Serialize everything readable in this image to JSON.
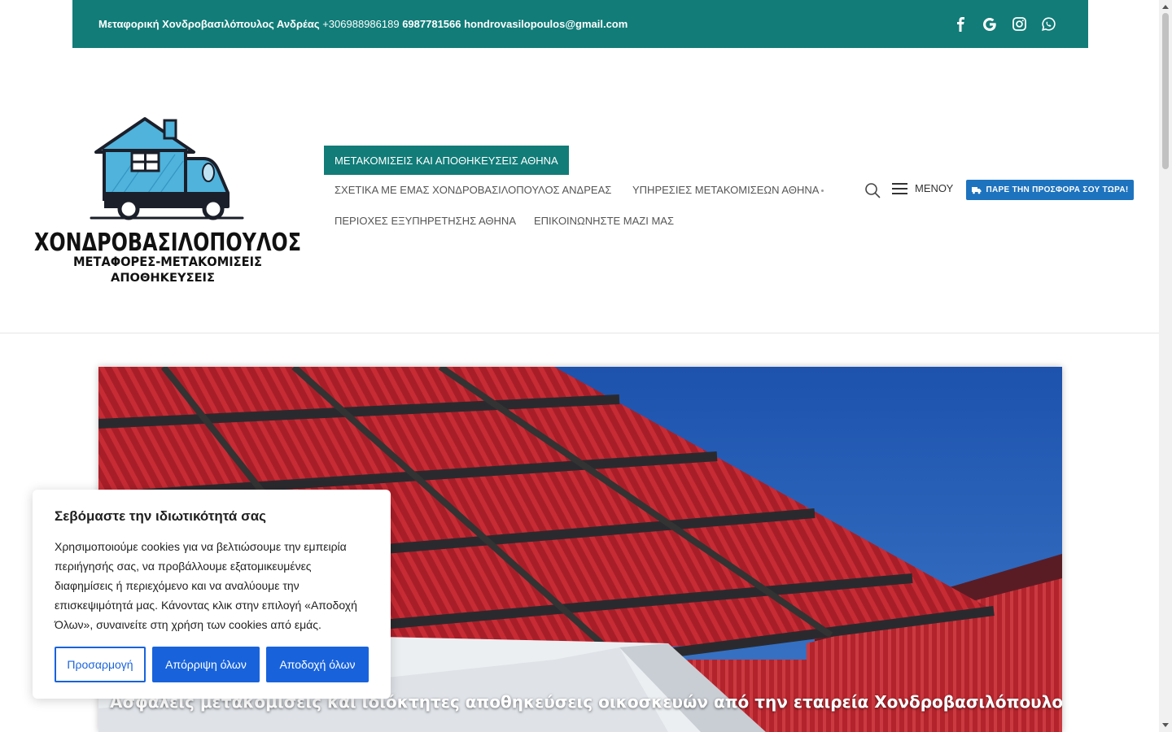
{
  "topbar": {
    "company": "Μεταφορική Χονδροβασιλόπουλος Ανδρέας ",
    "phone1": "+306988986189",
    "phone2": " 6987781566 ",
    "email": "hondrovasilopoulos@gmail.com",
    "social_icons": [
      "facebook-icon",
      "google-icon",
      "instagram-icon",
      "whatsapp-icon"
    ]
  },
  "logo": {
    "line1": "ΧΟΝΔΡΟΒΑΣΙΛΟΠΟΥΛΟΣ",
    "line2": "ΜΕΤΑΦΟΡΕΣ-ΜΕΤΑΚΟΜΙΣΕΙΣ",
    "line3": "ΑΠΟΘΗΚΕΥΣΕΙΣ"
  },
  "nav": {
    "active": "ΜΕΤΑΚΟΜΙΣΕΙΣ ΚΑΙ ΑΠΟΘΗΚΕΥΣΕΙΣ ΑΘΗΝΑ",
    "items": [
      "ΣΧΕΤΙΚΑ ΜΕ ΕΜΑΣ ΧΟΝΔΡΟΒΑΣΙΛΟΠΟΥΛΟΣ ΑΝΔΡΕΑΣ",
      "ΥΠΗΡΕΣΙΕΣ ΜΕΤΑΚΟΜΙΣΕΩΝ ΑΘΗΝΑ",
      "ΠΕΡΙΟΧΕΣ ΕΞΥΠΗΡΕΤΗΣΗΣ ΑΘΗΝΑ",
      "ΕΠΙΚΟΙΝΩΝΗΣΤΕ ΜΑΖΙ ΜΑΣ"
    ],
    "menu_label": "ΜΕΝΟΥ",
    "cta_label": "ΠΑΡΕ ΤΗΝ ΠΡΟΣΦΟΡΑ ΣΟΥ ΤΩΡΑ!"
  },
  "hero": {
    "caption": "Ασφαλείς μετακομίσεις και ιδιόκτητες αποθηκεύσεις οικοσκευών από την εταιρεία Χονδροβασιλόπουλος."
  },
  "cookie": {
    "title": "Σεβόμαστε την ιδιωτικότητά σας",
    "body": "Χρησιμοποιούμε cookies για να βελτιώσουμε την εμπειρία περιήγησής σας, να προβάλλουμε εξατομικευμένες διαφημίσεις ή περιεχόμενο και να αναλύουμε την επισκεψιμότητά μας. Κάνοντας κλικ στην επιλογή «Αποδοχή Όλων», συναινείτε στη χρήση των cookies από εμάς.",
    "customize": "Προσαρμογή",
    "reject": "Απόρριψη όλων",
    "accept": "Αποδοχή όλων"
  },
  "colors": {
    "brand_teal": "#117c78",
    "cta_blue": "#1e73be",
    "cookie_blue": "#1863dc"
  }
}
